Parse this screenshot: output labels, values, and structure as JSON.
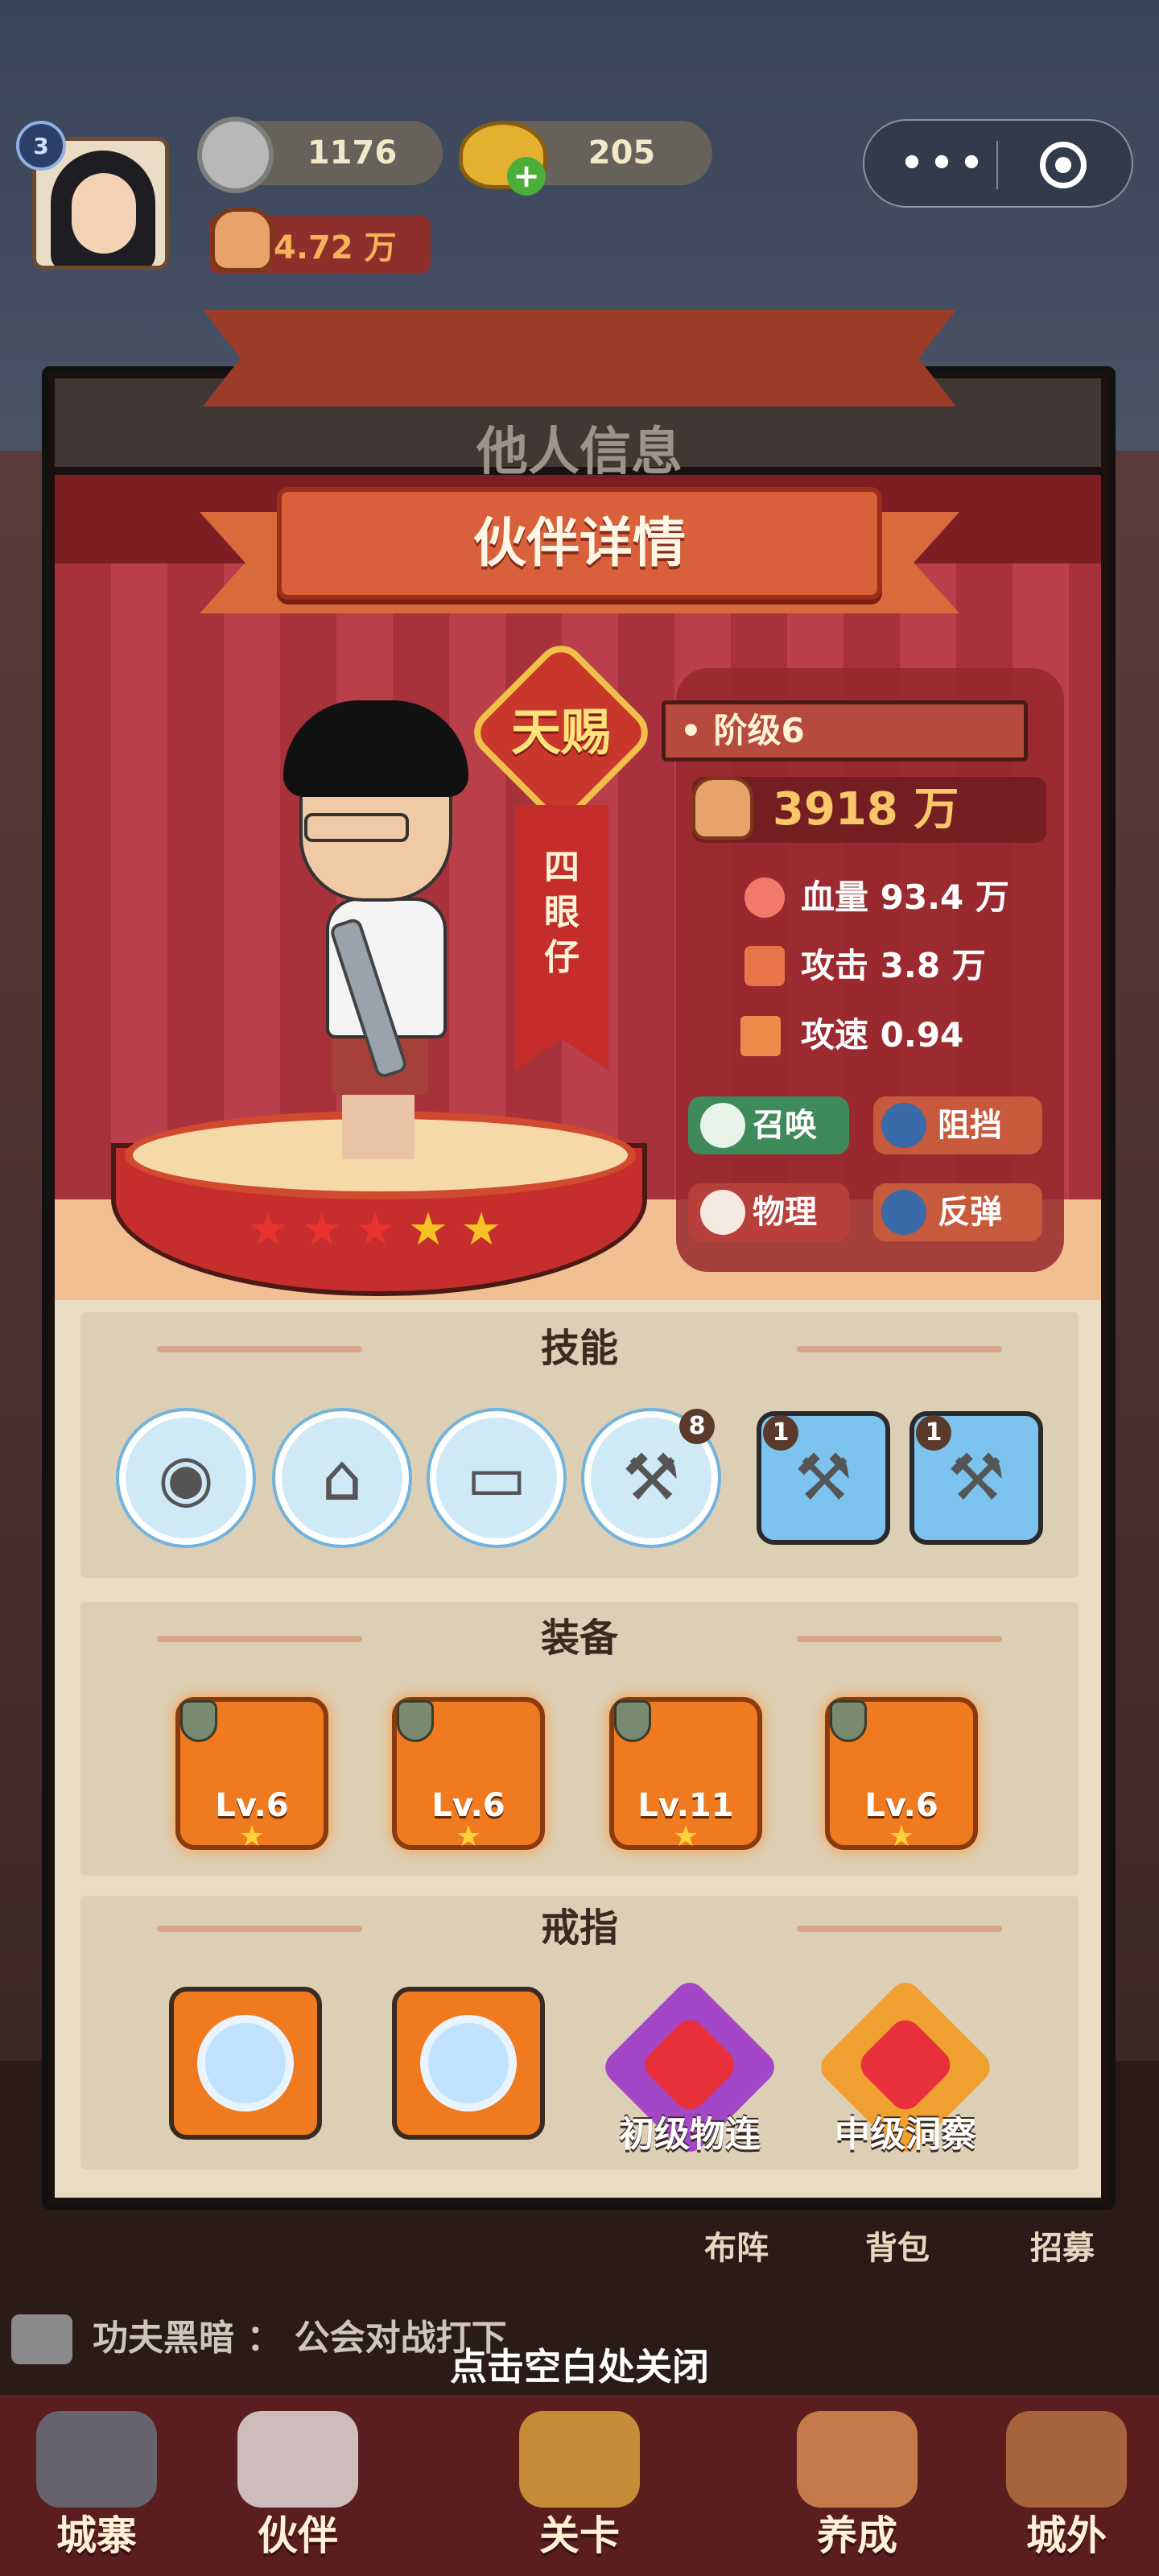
{
  "hud": {
    "player_level": "3",
    "silver": "1176",
    "gold": "205",
    "power": "4.72 万"
  },
  "capsule": {
    "more": "•••"
  },
  "background_title": "他人信息",
  "panel_title": "伙伴详情",
  "partner": {
    "rank": "天赐",
    "name": "四眼仔",
    "stars": 5,
    "tier": "阶级6",
    "power": "3918 万",
    "stats": [
      {
        "label": "血量",
        "value": "93.4 万",
        "icon": "heart-icon"
      },
      {
        "label": "攻击",
        "value": "3.8 万",
        "icon": "sword-icon"
      },
      {
        "label": "攻速",
        "value": "0.94",
        "icon": "wing-icon"
      }
    ],
    "tags": [
      "召唤",
      "阻挡",
      "物理",
      "反弹"
    ]
  },
  "sections": {
    "skills": {
      "title": "技能",
      "items": [
        {
          "icon": "tire-icon",
          "badge": ""
        },
        {
          "icon": "van-dash-icon",
          "badge": ""
        },
        {
          "icon": "van-icon",
          "badge": ""
        },
        {
          "icon": "wrench-icon",
          "badge": "8"
        },
        {
          "icon": "wrench-card-icon",
          "badge": "1"
        },
        {
          "icon": "hammer-card-icon",
          "badge": "1"
        }
      ]
    },
    "equipment": {
      "title": "装备",
      "items": [
        {
          "icon": "weapon-icon",
          "level": "Lv.6"
        },
        {
          "icon": "armor-icon",
          "level": "Lv.6"
        },
        {
          "icon": "hat-icon",
          "level": "Lv.11"
        },
        {
          "icon": "pants-icon",
          "level": "Lv.6"
        }
      ]
    },
    "rings": {
      "title": "戒指",
      "items": [
        {
          "icon": "ring-icon",
          "label": ""
        },
        {
          "icon": "ring-icon",
          "label": ""
        },
        {
          "icon": "red-gem-icon",
          "label": "初级物连"
        },
        {
          "icon": "red-gem-icon",
          "label": "中级洞察"
        }
      ]
    }
  },
  "side_buttons": [
    "布阵",
    "背包",
    "招募"
  ],
  "chat": {
    "sender": "功夫黑暗",
    "message": "：  公会对战打下"
  },
  "close_hint": "点击空白处关闭",
  "nav": [
    "城寨",
    "伙伴",
    "关卡",
    "养成",
    "城外"
  ]
}
